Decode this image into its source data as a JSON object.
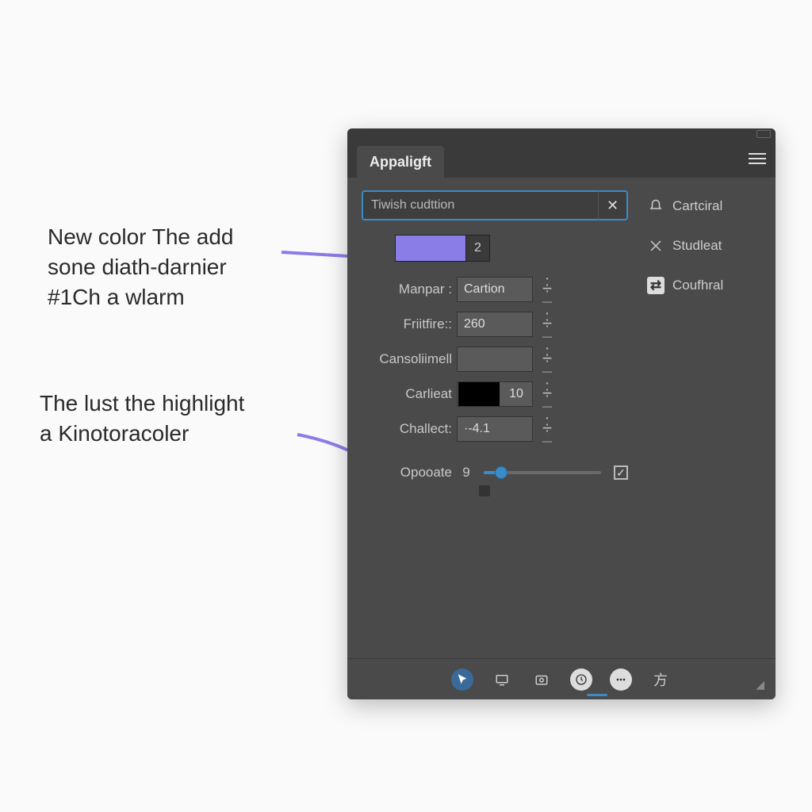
{
  "annotations": {
    "a1_line1": "New color The add",
    "a1_line2": "sone diath-darnier",
    "a1_line3": "#1Ch a wlarm",
    "a2_line1": "The lust the highlight",
    "a2_line2": "a Kinotoracoler"
  },
  "panel": {
    "tab_label": "Appaligft",
    "search_value": "Tiwish cudttion",
    "swatch_color": "#8b7de8",
    "swatch_value": "2",
    "props": {
      "mangar": {
        "label": "Manpar :",
        "value": "Cartion"
      },
      "friifire": {
        "label": "Friitfire::",
        "value": "260"
      },
      "consoli": {
        "label": "Cansoliimell",
        "value": ""
      },
      "carlieat": {
        "label": "Carlieat",
        "value": "10",
        "sw": "#000000"
      },
      "challect": {
        "label": "Challect:",
        "value": "·-4.1"
      }
    },
    "slider": {
      "label": "Opooate",
      "value": "9",
      "percent": 15,
      "checked": true
    },
    "side_buttons": {
      "b1": "Cartciral",
      "b2": "Studleat",
      "b3": "Coufhral"
    }
  }
}
